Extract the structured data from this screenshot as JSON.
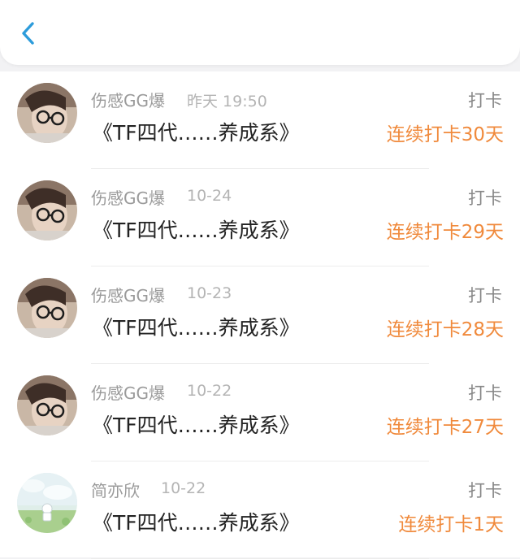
{
  "header": {
    "back_icon": "chevron-left-icon",
    "accent": "#2d9cdb"
  },
  "records": [
    {
      "name": "伤感GG爆",
      "time": "昨天 19:50",
      "type": "打卡",
      "title": "《TF四代……养成系》",
      "streak": "连续打卡30天"
    },
    {
      "name": "伤感GG爆",
      "time": "10-24",
      "type": "打卡",
      "title": "《TF四代……养成系》",
      "streak": "连续打卡29天"
    },
    {
      "name": "伤感GG爆",
      "time": "10-23",
      "type": "打卡",
      "title": "《TF四代……养成系》",
      "streak": "连续打卡28天"
    },
    {
      "name": "伤感GG爆",
      "time": "10-22",
      "type": "打卡",
      "title": "《TF四代……养成系》",
      "streak": "连续打卡27天"
    },
    {
      "name": "简亦欣",
      "time": "10-22",
      "type": "打卡",
      "title": "《TF四代……养成系》",
      "streak": "连续打卡1天"
    }
  ],
  "colors": {
    "streak": "#f08a3c",
    "name": "#9a9a9a",
    "title": "#222222"
  }
}
